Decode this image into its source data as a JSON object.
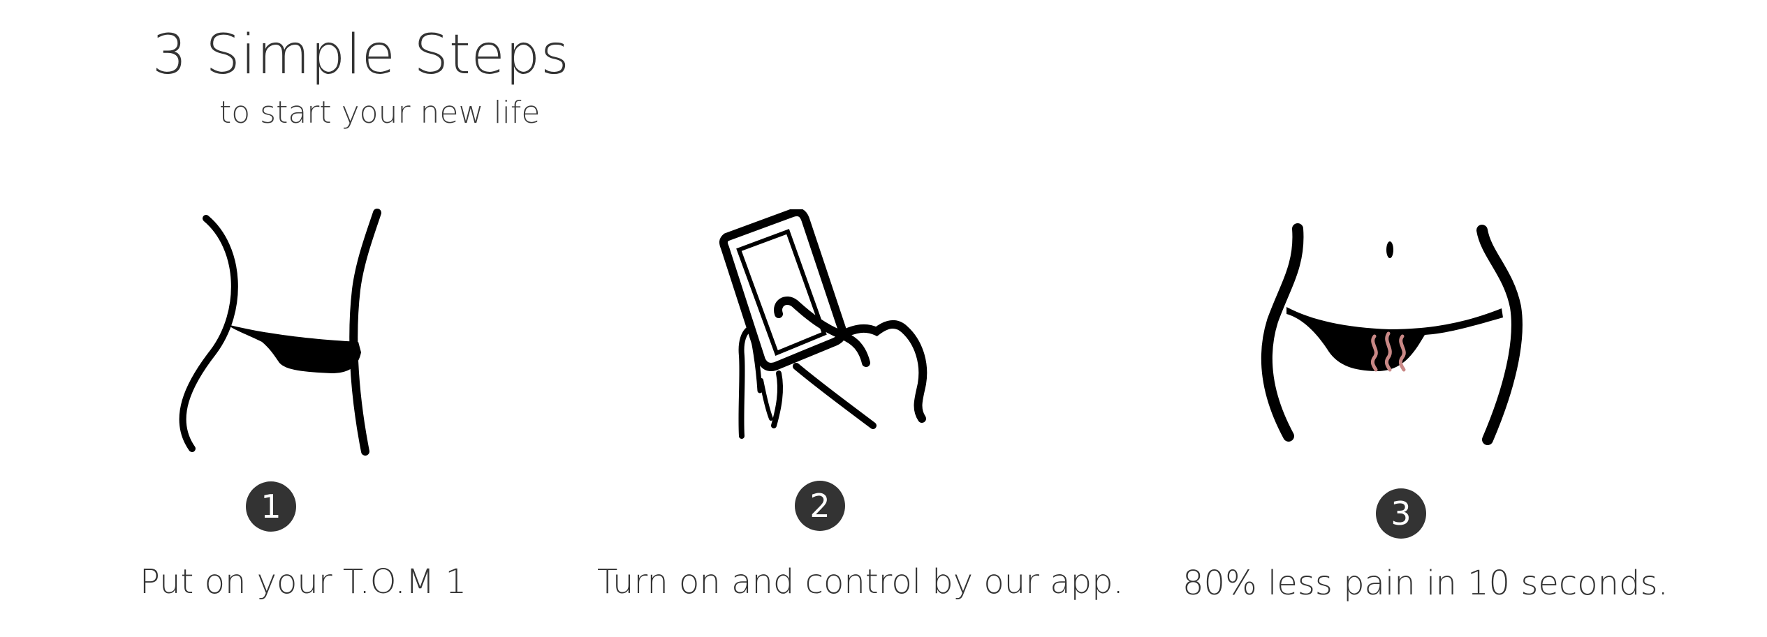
{
  "header": {
    "title": "3 Simple Steps",
    "subtitle": "to start your new life"
  },
  "accent_color": "#c98886",
  "badge_color": "#333333",
  "steps": [
    {
      "number": "1",
      "caption": "Put on your T.O.M 1",
      "icon": "waist-side-belt-icon"
    },
    {
      "number": "2",
      "caption": "Turn on and control by our app.",
      "icon": "hand-holding-phone-icon"
    },
    {
      "number": "3",
      "caption": "80% less pain in 10 seconds.",
      "icon": "belly-heat-belt-icon"
    }
  ]
}
